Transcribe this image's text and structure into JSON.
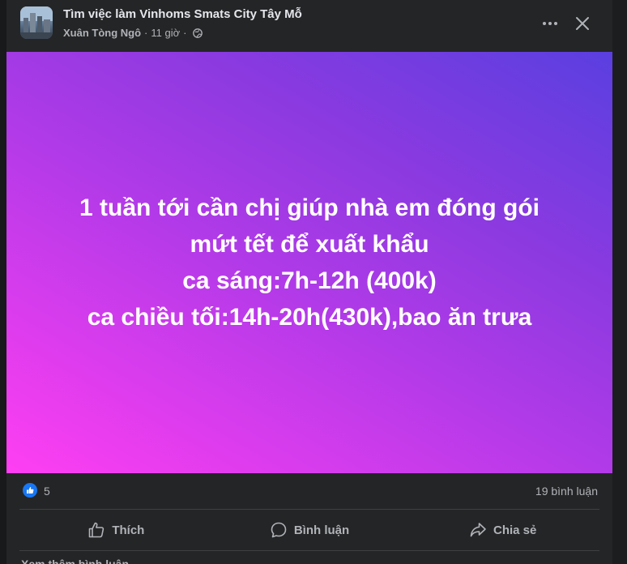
{
  "header": {
    "group_name": "Tìm việc làm Vinhoms Smats City Tây Mỗ",
    "author": "Xuân Tòng Ngô",
    "separator": "·",
    "time": "11 giờ",
    "privacy_icon": "globe-icon",
    "more_icon": "more-horizontal-icon",
    "close_icon": "close-icon"
  },
  "post": {
    "lines": [
      "1 tuần tới cần chị giúp nhà em đóng gói",
      "mứt tết để xuất khẩu",
      "ca sáng:7h-12h (400k)",
      "ca chiều tối:14h-20h(430k),bao ăn trưa"
    ],
    "background_gradient": [
      "#ff3ef2",
      "#b23ae8",
      "#8a3ae0",
      "#5a3fe0"
    ]
  },
  "stats": {
    "like_icon": "like-reaction-icon",
    "like_count": "5",
    "comments": "19 bình luận"
  },
  "actions": {
    "like": "Thích",
    "comment": "Bình luận",
    "share": "Chia sẻ"
  },
  "footer": {
    "more_comments": "Xem thêm bình luận"
  },
  "colors": {
    "card": "#242526",
    "text_primary": "#e4e6eb",
    "text_secondary": "#b0b3b8",
    "accent": "#1877f2"
  }
}
